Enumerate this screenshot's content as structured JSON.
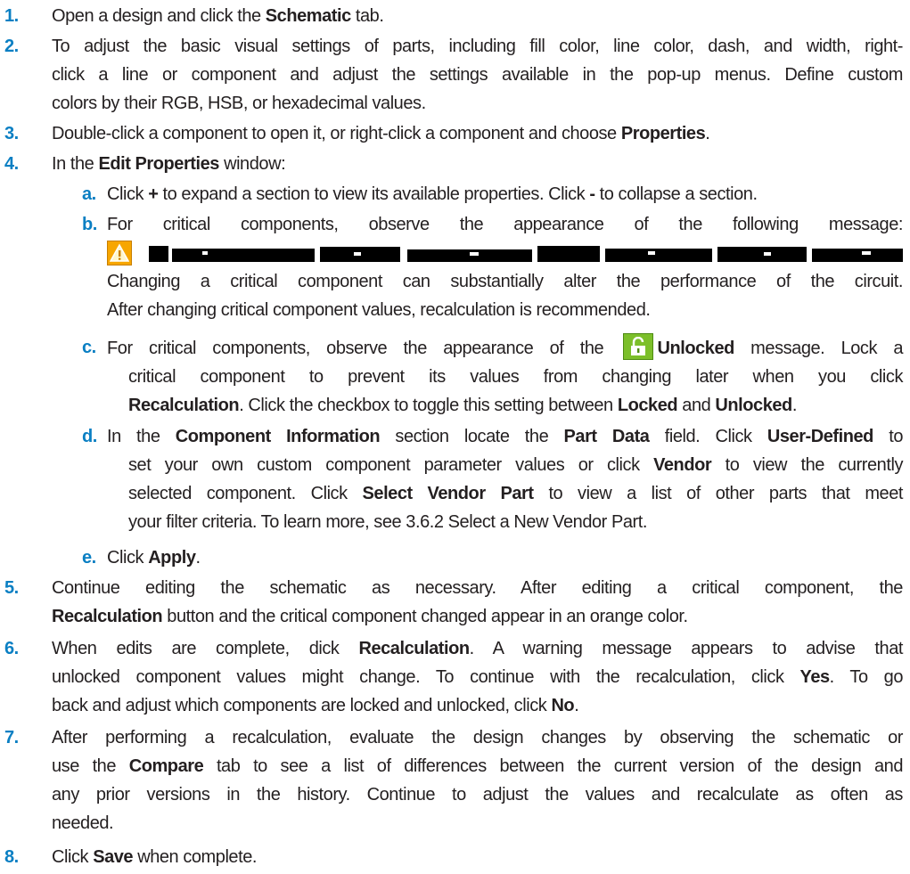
{
  "steps": {
    "s1": {
      "num": "1.",
      "pre": "Open a design and click the ",
      "b1": "Schematic",
      "post": " tab."
    },
    "s2": {
      "num": "2.",
      "line1": "To adjust the basic visual settings of parts, including fill color, line color, dash, and width, right-",
      "line2": "click a line or component and adjust the settings available in the pop-up menus. Define custom",
      "line3": "colors by their RGB, HSB, or hexadecimal values."
    },
    "s3": {
      "num": "3.",
      "pre": "Double-click a component to open it, or right-click a component and choose ",
      "b1": "Properties",
      "post": "."
    },
    "s4": {
      "num": "4.",
      "pre": "In the ",
      "b1": "Edit Properties",
      "post": " window:"
    },
    "s5": {
      "num": "5.",
      "line1": "Continue editing the schematic as necessary. After editing a critical component, the",
      "b1": "Recalculation",
      "line2_post": " button and the critical component changed appear in an orange color."
    },
    "s6": {
      "num": "6.",
      "l1_pre": "When edits are complete, dick ",
      "l1_b": "Recalculation",
      "l1_post": ". A warning message appears to advise that",
      "l2_pre": "unlocked component values might change. To continue with the recalculation, click ",
      "l2_b": "Yes",
      "l2_post": ". To go",
      "l3_pre": "back and adjust which components are locked and unlocked, click ",
      "l3_b": "No",
      "l3_post": "."
    },
    "s7": {
      "num": "7.",
      "line1": "After performing a recalculation, evaluate the design changes by observing the schematic or",
      "l2_pre": "use the ",
      "l2_b": "Compare",
      "l2_post": " tab to see a list of differences between the current version of the design and",
      "line3": "any prior versions in the history. Continue to adjust the values and recalculate as often as",
      "line4": "needed."
    },
    "s8": {
      "num": "8.",
      "pre": "Click ",
      "b1": "Save",
      "post": " when complete."
    }
  },
  "substeps": {
    "a": {
      "num": "a.",
      "pre": "Click ",
      "b1": "+",
      "mid": " to expand a section to view its available properties. Click ",
      "b2": "-",
      "post": " to collapse a section."
    },
    "b": {
      "num": "b.",
      "line1": "For critical components, observe the appearance of the following message:",
      "line3": "Changing a critical component can substantially alter the performance of the circuit.",
      "line4": "After changing critical component values, recalculation is recommended."
    },
    "c": {
      "num": "c.",
      "l1_pre": "For critical components, observe the appearance of the ",
      "l1_b": "Unlocked",
      "l1_post": " message. Lock a",
      "line2": "critical component to prevent its values from changing later when you click",
      "l3_b1": "Recalculation",
      "l3_mid": ". Click the checkbox to toggle this setting between ",
      "l3_b2": "Locked",
      "l3_and": " and ",
      "l3_b3": "Unlocked",
      "l3_post": "."
    },
    "d": {
      "num": "d.",
      "l1_pre": "In the ",
      "l1_b1": "Component Information",
      "l1_mid": " section locate the ",
      "l1_b2": "Part Data",
      "l1_mid2": " field. Click ",
      "l1_b3": "User-Defined",
      "l1_post": " to",
      "l2_pre": "set your own custom component parameter values or click ",
      "l2_b": "Vendor",
      "l2_post": " to view the currently",
      "l3_pre": "selected component. Click ",
      "l3_b": "Select Vendor Part",
      "l3_post": " to view a list of other parts that meet",
      "line4": "your filter criteria. To learn more, see 3.6.2 Select a New Vendor Part."
    },
    "e": {
      "num": "e.",
      "pre": "Click ",
      "b1": "Apply",
      "post": "."
    }
  },
  "colors": {
    "number_blue": "#0a7fc3",
    "text": "#231f20",
    "warning_orange": "#f7a600",
    "lock_green": "#7cbf2a"
  },
  "icons": [
    "warning-icon",
    "unlocked-icon"
  ]
}
